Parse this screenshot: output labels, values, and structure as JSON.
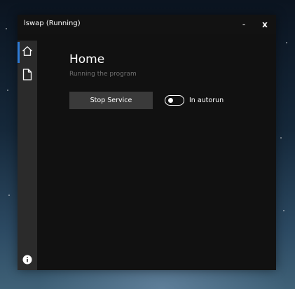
{
  "window": {
    "title": "lswap (Running)",
    "minimize_label": "-",
    "close_label": "x"
  },
  "sidebar": {
    "items": [
      {
        "icon": "home-icon",
        "active": true
      },
      {
        "icon": "document-icon",
        "active": false
      },
      {
        "icon": "info-icon",
        "active": false
      }
    ]
  },
  "main": {
    "heading": "Home",
    "subtitle": "Running the program",
    "stop_button_label": "Stop Service",
    "autorun_label": "In autorun",
    "autorun_enabled": false
  },
  "colors": {
    "accent": "#2f7cd6",
    "window_bg": "#111111",
    "sidebar_bg": "#2b2b2b",
    "button_bg": "#3a3a3a",
    "subtitle_text": "#6f6f6f"
  }
}
